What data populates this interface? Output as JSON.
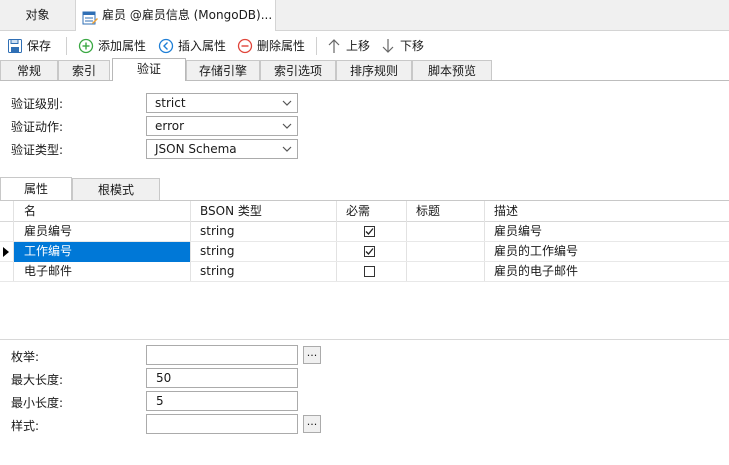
{
  "doc_tabs": [
    {
      "label": "对象"
    },
    {
      "label": "雇员 @雇员信息 (MongoDB)..."
    }
  ],
  "toolbar": {
    "save": "保存",
    "add_attr": "添加属性",
    "insert_attr": "插入属性",
    "delete_attr": "删除属性",
    "move_up": "上移",
    "move_down": "下移"
  },
  "prop_tabs": [
    "常规",
    "索引",
    "验证",
    "存储引擎",
    "索引选项",
    "排序规则",
    "脚本预览"
  ],
  "active_prop_tab": "验证",
  "validation": {
    "level_label": "验证级别:",
    "level_value": "strict",
    "action_label": "验证动作:",
    "action_value": "error",
    "type_label": "验证类型:",
    "type_value": "JSON Schema"
  },
  "sub_tabs": [
    "属性",
    "根模式"
  ],
  "grid": {
    "columns": [
      "名",
      "BSON 类型",
      "必需",
      "标题",
      "描述"
    ],
    "rows": [
      {
        "name": "雇员编号",
        "type": "string",
        "required": true,
        "title": "",
        "desc": "雇员编号"
      },
      {
        "name": "工作编号",
        "type": "string",
        "required": true,
        "title": "",
        "desc": "雇员的工作编号",
        "selected": true
      },
      {
        "name": "电子邮件",
        "type": "string",
        "required": false,
        "title": "",
        "desc": "雇员的电子邮件"
      }
    ]
  },
  "details": {
    "enum_label": "枚举:",
    "enum_value": "",
    "max_len_label": "最大长度:",
    "max_len_value": "50",
    "min_len_label": "最小长度:",
    "min_len_value": "5",
    "pattern_label": "样式:",
    "pattern_value": "",
    "ellipsis": "..."
  },
  "colors": {
    "selection": "#0078d7",
    "add_icon": "#3aa843",
    "insert_icon": "#1f7fd6",
    "delete_icon": "#e0453a",
    "save_icon": "#2f6fb5"
  }
}
